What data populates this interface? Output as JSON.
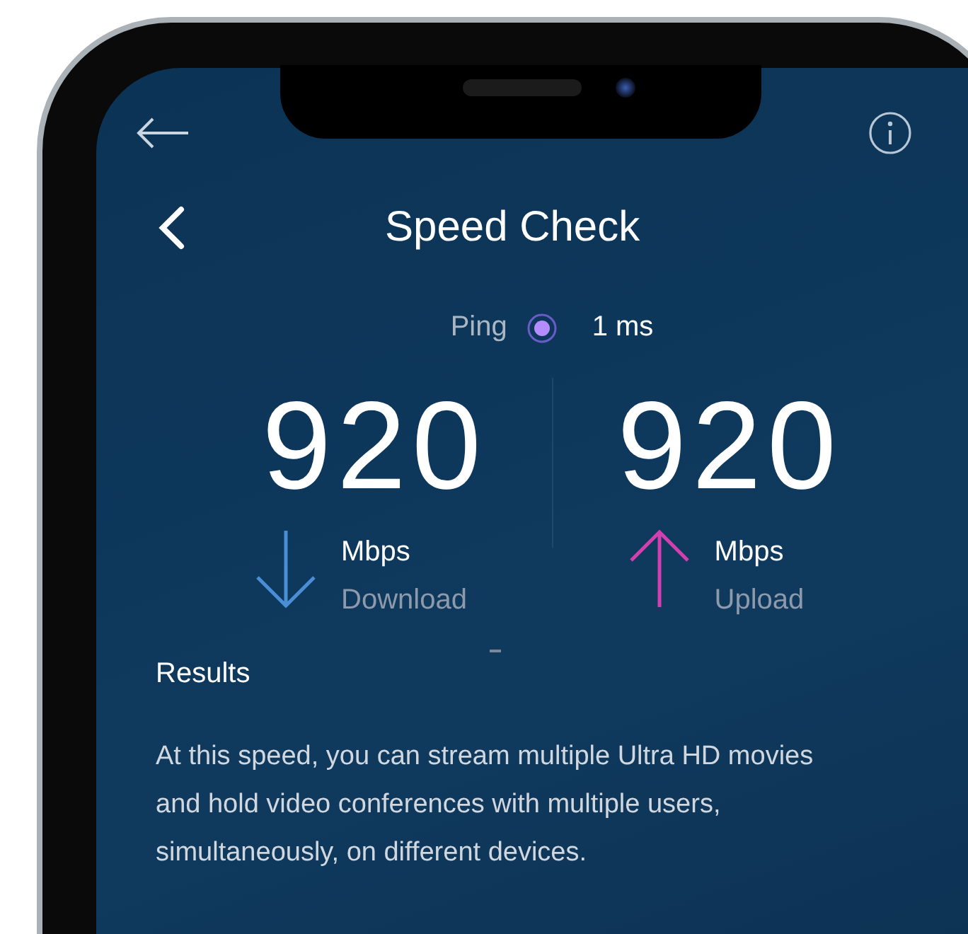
{
  "title": "Speed Check",
  "ping": {
    "label": "Ping",
    "value": "1 ms"
  },
  "speeds": [
    {
      "kind": "download",
      "value": "920",
      "unit": "Mbps",
      "label": "Download",
      "color": "#4a8fd6"
    },
    {
      "kind": "upload",
      "value": "920",
      "unit": "Mbps",
      "label": "Upload",
      "color": "#d23fb0"
    }
  ],
  "results": {
    "heading": "Results",
    "text": "At this speed, you can stream multiple Ultra HD movies and hold video conferences with multiple users, simultaneously, on different devices."
  }
}
